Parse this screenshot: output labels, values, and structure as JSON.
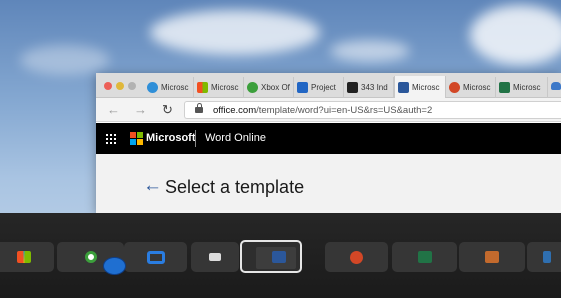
{
  "browser": {
    "tabs": [
      {
        "label": "Microsc",
        "icon": "edge-icon",
        "color": "#2f8fd8"
      },
      {
        "label": "Microsc",
        "icon": "microsoft-store-icon",
        "color": "#f25022"
      },
      {
        "label": "Xbox Of",
        "icon": "xbox-icon",
        "color": "#3c9f3c"
      },
      {
        "label": "Project",
        "icon": "project-icon",
        "color": "#2266c4"
      },
      {
        "label": "343 Ind",
        "icon": "343-icon",
        "color": "#222222"
      },
      {
        "label": "Microsc",
        "icon": "word-icon",
        "color": "#2b579a",
        "active": true
      },
      {
        "label": "Microsc",
        "icon": "powerpoint-icon",
        "color": "#d24726"
      },
      {
        "label": "Microsc",
        "icon": "excel-icon",
        "color": "#217346"
      }
    ],
    "url_domain": "office.com",
    "url_path": "/template/word?ui=en-US&rs=US&auth=2"
  },
  "ms_header": {
    "brand": "Microsoft",
    "app": "Word Online"
  },
  "page": {
    "title": "Select a template"
  },
  "taskbar": {
    "items": [
      {
        "name": "taskbar-microsoft-store",
        "icon": "microsoft-store-icon",
        "color": "#f25022"
      },
      {
        "name": "taskbar-xbox",
        "icon": "xbox-icon",
        "color": "#ffffff"
      },
      {
        "name": "taskbar-project",
        "icon": "project-icon",
        "color": "#2a7de1"
      },
      {
        "name": "taskbar-343-industries",
        "icon": "343-icon",
        "color": "#dcdcdc"
      },
      {
        "name": "taskbar-word",
        "icon": "word-icon",
        "color": "#2b579a",
        "active": true
      },
      {
        "name": "taskbar-powerpoint",
        "icon": "powerpoint-icon",
        "color": "#d24726"
      },
      {
        "name": "taskbar-excel",
        "icon": "excel-icon",
        "color": "#217346"
      },
      {
        "name": "taskbar-sway",
        "icon": "sway-icon",
        "color": "#c36a2d"
      },
      {
        "name": "taskbar-edge",
        "icon": "edge-icon",
        "color": "#2f6fb0"
      }
    ]
  }
}
